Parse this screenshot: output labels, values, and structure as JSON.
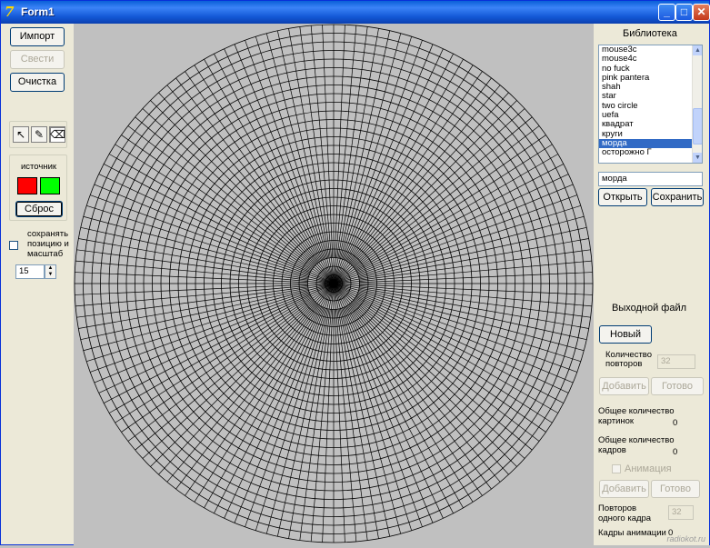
{
  "window": {
    "title": "Form1"
  },
  "left": {
    "import_label": "Импорт",
    "merge_label": "Свести",
    "clear_label": "Очистка",
    "source_label": "источник",
    "source_colors": [
      "#ff0000",
      "#00ff00"
    ],
    "reset_label": "Сброс",
    "keep_position_label_1": "сохранять",
    "keep_position_label_2": "позицию и",
    "keep_position_label_3": "масштаб",
    "spin_value": "15"
  },
  "canvas": {
    "rings": 30,
    "spokes": 144,
    "line_color": "#000000",
    "background": "#c0c0c0"
  },
  "library": {
    "title": "Библиотека",
    "items": [
      "mouse3c",
      "mouse4c",
      "no fuck",
      "pink pantera",
      "shah",
      "star",
      "two circle",
      "uefa",
      "квадрат",
      "круги",
      "морда",
      "осторожно Г"
    ],
    "selected": "морда",
    "name_value": "морда",
    "open_label": "Открыть",
    "save_label": "Сохранить"
  },
  "output": {
    "title": "Выходной файл",
    "new_label": "Новый",
    "repeat_label_1": "Количество",
    "repeat_label_2": "повторов",
    "repeat_value": "32",
    "add_label": "Добавить",
    "done_label": "Готово",
    "total_pics_label_1": "Общее количество",
    "total_pics_label_2": "картинок",
    "total_pics_value": "0",
    "total_frames_label_1": "Общее количество",
    "total_frames_label_2": "кадров",
    "total_frames_value": "0",
    "animation_label": "Анимация",
    "add2_label": "Добавить",
    "done2_label": "Готово",
    "frame_repeat_label_1": "Повторов",
    "frame_repeat_label_2": "одного кадра",
    "frame_repeat_value": "32",
    "anim_frames_label": "Кадры анимации",
    "anim_frames_value": "0"
  },
  "watermark": "radiokot.ru"
}
